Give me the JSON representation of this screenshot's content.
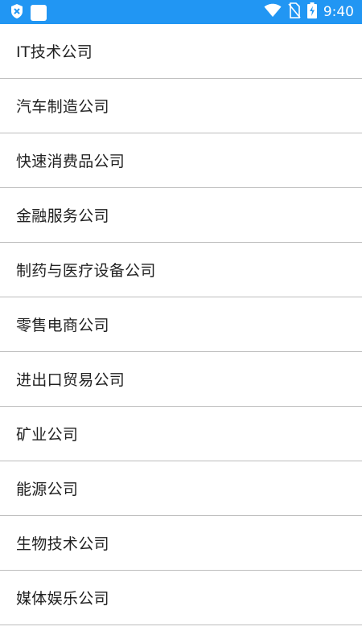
{
  "status_bar": {
    "time": "9:40",
    "icons": [
      "shield-icon",
      "notification-square-icon",
      "wifi-icon",
      "no-sim-icon",
      "battery-charging-icon"
    ],
    "background": "#2196f3"
  },
  "companies": [
    {
      "label": "IT技术公司"
    },
    {
      "label": "汽车制造公司"
    },
    {
      "label": "快速消费品公司"
    },
    {
      "label": "金融服务公司"
    },
    {
      "label": "制药与医疗设备公司"
    },
    {
      "label": "零售电商公司"
    },
    {
      "label": "进出口贸易公司"
    },
    {
      "label": "矿业公司"
    },
    {
      "label": "能源公司"
    },
    {
      "label": "生物技术公司"
    },
    {
      "label": "媒体娱乐公司"
    }
  ]
}
